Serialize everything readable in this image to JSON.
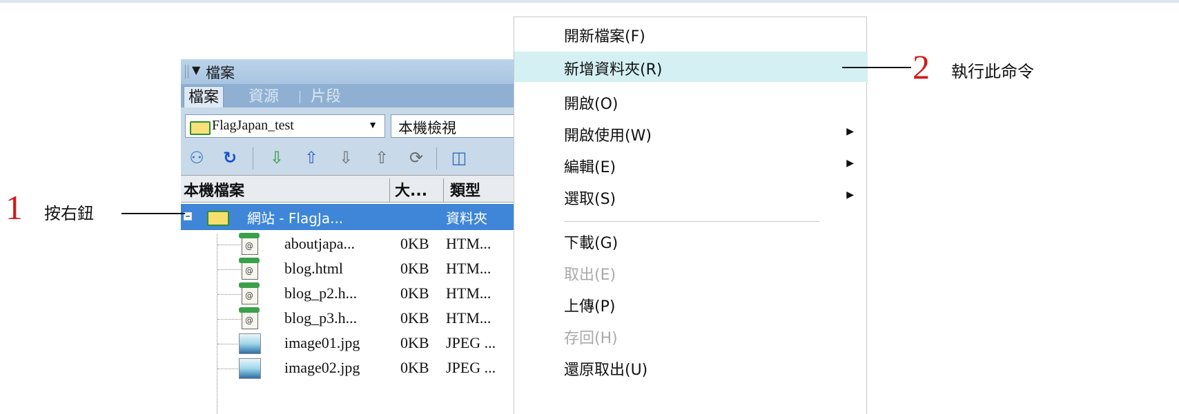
{
  "panel": {
    "title": "檔案",
    "tabs": [
      {
        "label": "檔案"
      },
      {
        "label": "資源"
      },
      {
        "label": "片段"
      }
    ],
    "site_select": "FlagJapan_test",
    "view_select": "本機檢視",
    "headers": {
      "name": "本機檔案",
      "size": "大...",
      "type": "類型"
    },
    "root": {
      "name": "網站 - FlagJa...",
      "type": "資料夾"
    },
    "files": [
      {
        "name": "aboutjapa...",
        "size": "0KB",
        "type": "HTM...",
        "icon": "html-file-icon"
      },
      {
        "name": "blog.html",
        "size": "0KB",
        "type": "HTM...",
        "icon": "html-file-icon"
      },
      {
        "name": "blog_p2.h...",
        "size": "0KB",
        "type": "HTM...",
        "icon": "html-file-icon"
      },
      {
        "name": "blog_p3.h...",
        "size": "0KB",
        "type": "HTM...",
        "icon": "html-file-icon"
      },
      {
        "name": "image01.jpg",
        "size": "0KB",
        "type": "JPEG ...",
        "icon": "jpeg-file-icon"
      },
      {
        "name": "image02.jpg",
        "size": "0KB",
        "type": "JPEG ...",
        "icon": "jpeg-file-icon"
      }
    ]
  },
  "menu": {
    "items": [
      {
        "label": "開新檔案(F)"
      },
      {
        "label": "新增資料夾(R)",
        "highlighted": true
      },
      {
        "label": "開啟(O)"
      },
      {
        "label": "開啟使用(W)",
        "submenu": true
      },
      {
        "label": "編輯(E)",
        "submenu": true
      },
      {
        "label": "選取(S)",
        "submenu": true
      },
      {
        "label": "下載(G)"
      },
      {
        "label": "取出(E)",
        "disabled": true
      },
      {
        "label": "上傳(P)"
      },
      {
        "label": "存回(H)",
        "disabled": true
      },
      {
        "label": "還原取出(U)"
      }
    ]
  },
  "annotations": {
    "step1": {
      "num": "1",
      "text": "按右鈕"
    },
    "step2": {
      "num": "2",
      "text": "執行此命令"
    }
  },
  "colors": {
    "selection": "#3f86d8",
    "menu_highlight": "#d4f0f2",
    "annotation_number": "#d11a1a"
  }
}
